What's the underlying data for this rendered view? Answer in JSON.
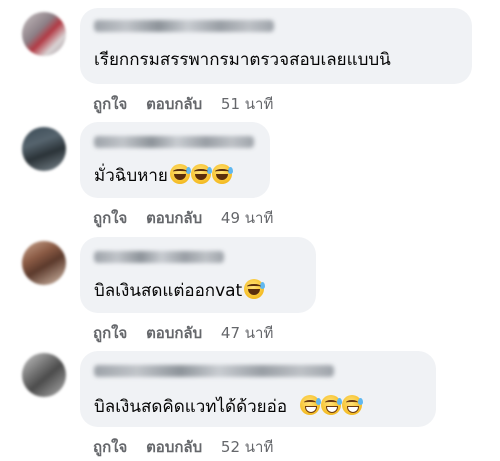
{
  "comments": [
    {
      "text": "เรียกกรมสรรพากรมาตรวจสอบเลยแบบนิ",
      "emojis": [],
      "like_label": "ถูกใจ",
      "reply_label": "ตอบกลับ",
      "time": "51 นาที"
    },
    {
      "text": "มั่วฉิบหาย",
      "emojis": [
        "rofl-emoji",
        "rofl-emoji",
        "rofl-emoji"
      ],
      "like_label": "ถูกใจ",
      "reply_label": "ตอบกลับ",
      "time": "49 นาที"
    },
    {
      "text": "บิลเงินสดแต่ออกvat",
      "emojis": [
        "rofl-emoji"
      ],
      "like_label": "ถูกใจ",
      "reply_label": "ตอบกลับ",
      "time": "47 นาที"
    },
    {
      "text": "บิลเงินสดคิดแวทได้ด้วยอ่อ",
      "emojis": [
        "grinning-sweat-emoji",
        "grinning-sweat-emoji",
        "grinning-sweat-emoji"
      ],
      "like_label": "ถูกใจ",
      "reply_label": "ตอบกลับ",
      "time": "52 นาที"
    }
  ],
  "colors": {
    "bubble": "#f0f2f5",
    "action_text": "#65676b",
    "body_text": "#050505"
  }
}
